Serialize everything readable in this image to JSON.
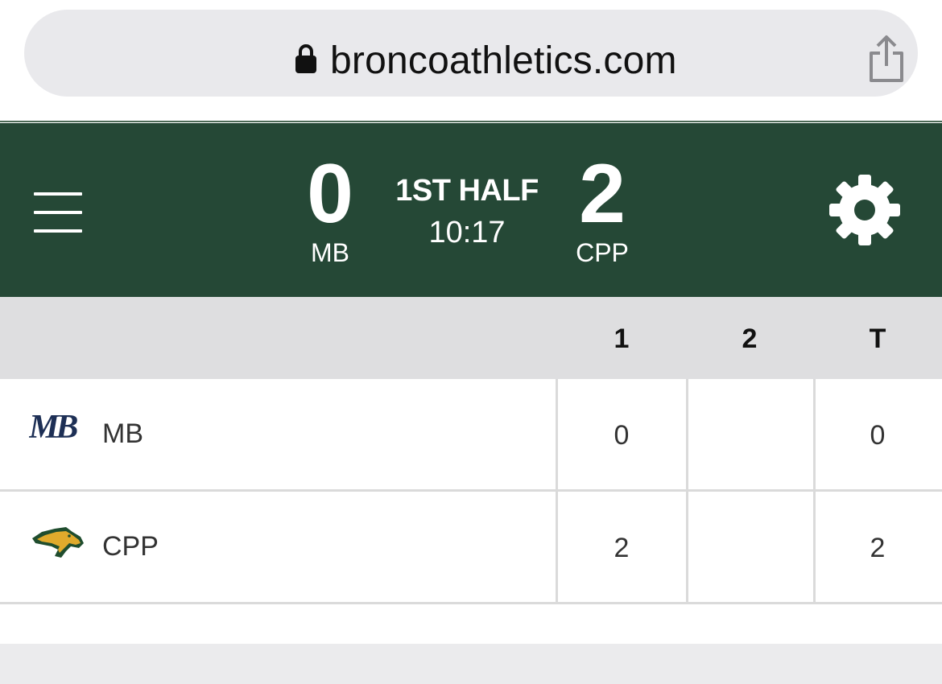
{
  "browser": {
    "url": "broncoathletics.com",
    "lock_icon": "lock-icon",
    "share_icon": "share-icon"
  },
  "scoreboard": {
    "menu_icon": "hamburger-menu-icon",
    "settings_icon": "gear-icon",
    "home": {
      "abbr": "MB",
      "score": "0"
    },
    "away": {
      "abbr": "CPP",
      "score": "2"
    },
    "period": "1ST HALF",
    "clock": "10:17",
    "colors": {
      "background": "#254836",
      "text": "#ffffff"
    }
  },
  "linescore": {
    "headers": [
      "1",
      "2",
      "T"
    ],
    "rows": [
      {
        "team": "MB",
        "logo": "mb-logo",
        "periods": [
          "0",
          ""
        ],
        "total": "0"
      },
      {
        "team": "CPP",
        "logo": "bronco-horse-logo",
        "periods": [
          "2",
          ""
        ],
        "total": "2"
      }
    ]
  }
}
